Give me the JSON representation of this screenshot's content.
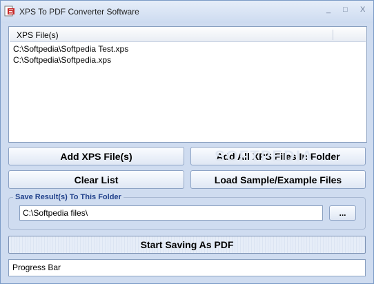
{
  "window": {
    "title": "XPS To PDF Converter Software",
    "controls": {
      "minimize": "_",
      "maximize": "□",
      "close": "X"
    }
  },
  "file_list": {
    "column_header": "XPS File(s)",
    "items": [
      "C:\\Softpedia\\Softpedia Test.xps",
      "C:\\Softpedia\\Softpedia.xps"
    ]
  },
  "buttons": {
    "add_files": "Add XPS File(s)",
    "add_folder": "Add All XPS Files In Folder",
    "clear_list": "Clear List",
    "load_samples": "Load Sample/Example Files",
    "browse": "...",
    "start": "Start Saving As PDF"
  },
  "watermark": "SOFTPEDIA",
  "output": {
    "group_label": "Save Result(s) To This Folder",
    "folder_path": "C:\\Softpedia files\\"
  },
  "progress": {
    "label": "Progress Bar"
  }
}
